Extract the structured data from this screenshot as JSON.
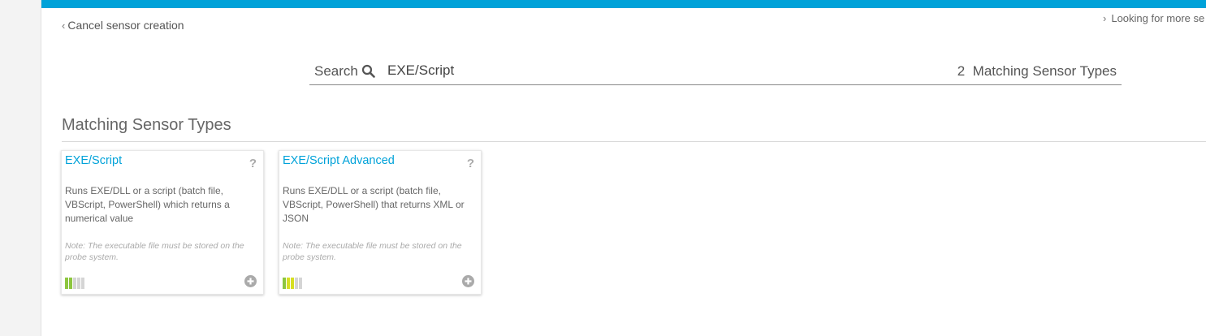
{
  "nav": {
    "cancel_label": "Cancel sensor creation",
    "more_label": "Looking for more se"
  },
  "search": {
    "label": "Search",
    "value": "EXE/Script",
    "match_count": "2",
    "match_label": "Matching Sensor Types"
  },
  "section": {
    "title": "Matching Sensor Types"
  },
  "colors": {
    "accent": "#00a2d9",
    "perf_green": "#8dc63f",
    "perf_yellow": "#d7df23",
    "perf_empty": "#d5d5d5"
  },
  "cards": [
    {
      "title": "EXE/Script",
      "description": "Runs EXE/DLL or a script (batch file, VBScript, PowerShell) which returns a numerical value",
      "note": "Note: The executable file must be stored on the probe system.",
      "performance": [
        "green",
        "green",
        "empty",
        "empty",
        "empty"
      ],
      "help_icon": "question-mark",
      "add_icon": "plus-circle"
    },
    {
      "title": "EXE/Script Advanced",
      "description": "Runs EXE/DLL or a script (batch file, VBScript, PowerShell) that returns XML or JSON",
      "note": "Note: The executable file must be stored on the probe system.",
      "performance": [
        "green",
        "yellow",
        "yellow",
        "empty",
        "empty"
      ],
      "help_icon": "question-mark",
      "add_icon": "plus-circle"
    }
  ]
}
